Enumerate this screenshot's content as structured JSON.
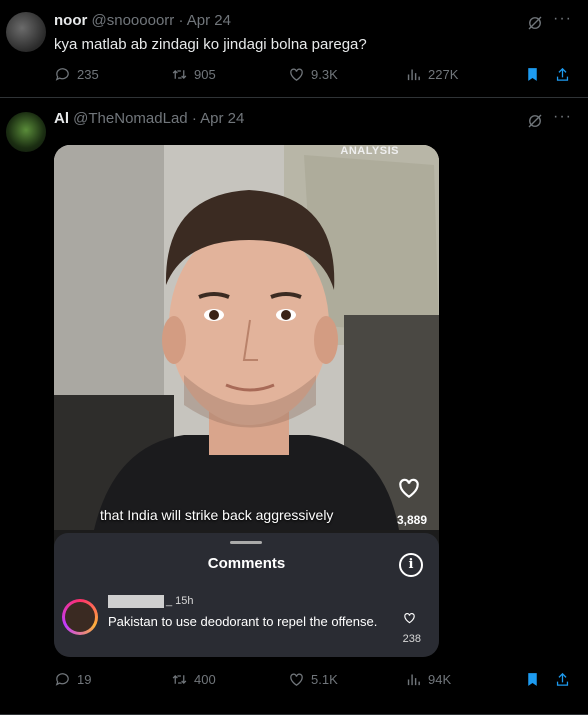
{
  "tweets": [
    {
      "name": "noor",
      "handle": "@snooooorr",
      "sep": "·",
      "date": "Apr 24",
      "text": "kya matlab ab zindagi ko jindagi bolna parega?",
      "replies": "235",
      "retweets": "905",
      "likes": "9.3K",
      "views": "227K",
      "more": "···"
    },
    {
      "name": "Al",
      "handle": "@TheNomadLad",
      "sep": "·",
      "date": "Apr 24",
      "replies": "19",
      "retweets": "400",
      "likes": "5.1K",
      "views": "94K",
      "more": "···",
      "media": {
        "badge": "ANALYSIS",
        "caption": "that India will strike back aggressively",
        "like_count": "3,889",
        "comments_title": "Comments",
        "info": "i",
        "comment": {
          "time": "_ 15h",
          "text": "Pakistan to use deodorant to repel the offense.",
          "likes": "238"
        }
      }
    }
  ],
  "colors": {
    "background": "#000000",
    "muted": "#71767b",
    "text": "#e7e9ea",
    "bookmark_active": "#1d9bf0",
    "divider": "#2f3336"
  },
  "icons": [
    "reply-icon",
    "retweet-icon",
    "like-icon",
    "views-icon",
    "bookmark-icon",
    "share-icon",
    "grok-icon",
    "more-icon",
    "heart-icon",
    "info-icon"
  ]
}
